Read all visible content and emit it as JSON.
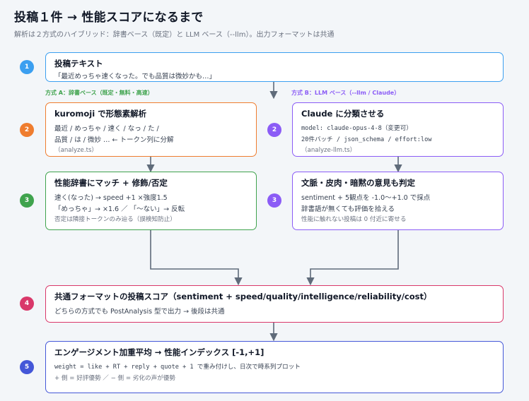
{
  "title": "投稿１件 → 性能スコアになるまで",
  "subtitle": "解析は２方式のハイブリッド：辞書ベース（既定）と LLM ベース（--llm）。出力フォーマットは共通",
  "lanes": {
    "a": "方式 A：辞書ベース（既定・無料・高速）",
    "b": "方式 B：LLM ベース（--llm / Claude）"
  },
  "colors": {
    "blue": "#3b9ff0",
    "orange": "#ef7d2f",
    "green": "#3fa34d",
    "purple": "#8b5cf6",
    "red": "#d9386a",
    "indigo": "#4457d8",
    "lane_a": "#3fa34d",
    "lane_b": "#8b5cf6",
    "arrow": "#5f6b7a"
  },
  "nodes": {
    "input": {
      "step": "1",
      "title": "投稿テキスト",
      "lines": [
        "「最近めっちゃ速くなった。でも品質は微妙かも…」"
      ]
    },
    "a1": {
      "step": "2",
      "title": "kuromoji で形態素解析",
      "lines": [
        "最近 / めっちゃ / 速く / なっ / た /",
        "品質 / は / 微妙 … ← トークン列に分解"
      ],
      "note": "（analyze.ts）"
    },
    "b1": {
      "step": "2",
      "title": "Claude に分類させる",
      "lines": [
        "model: claude-opus-4-8（変更可）",
        "20件バッチ / json_schema / effort:low"
      ],
      "note": "（analyze-llm.ts）"
    },
    "a2": {
      "step": "3",
      "title": "性能辞書にマッチ + 修飾/否定",
      "lines": [
        "速く(なった) → speed +1 ×強度1.5",
        "「めっちゃ」→ ×1.6 ／ 「〜ない」→ 反転"
      ],
      "note": "否定は隣接トークンのみ辿る（誤検知防止）"
    },
    "b2": {
      "step": "3",
      "title": "文脈・皮肉・暗黙の意見も判定",
      "lines": [
        "sentiment + 5観点を -1.0〜+1.0 で採点",
        "辞書語が無くても評価を拾える"
      ],
      "note": "性能に触れない投稿は 0 付近に寄せる"
    },
    "merge": {
      "step": "4",
      "title": "共通フォーマットの投稿スコア（sentiment + speed/quality/intelligence/reliability/cost）",
      "lines": [
        "どちらの方式でも PostAnalysis 型で出力 → 後段は共通"
      ]
    },
    "final": {
      "step": "5",
      "title": "エンゲージメント加重平均 → 性能インデックス [-1,+1]",
      "lines": [
        "weight = like + RT + reply + quote + 1 で重み付けし、日次で時系列プロット"
      ],
      "note": "+ 側 = 好評優勢 ／ − 側 = 劣化の声が優勢"
    }
  }
}
